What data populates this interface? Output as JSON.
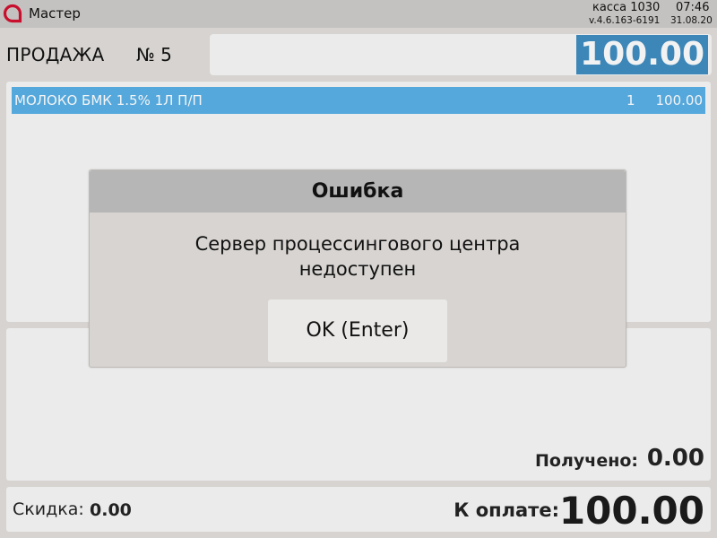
{
  "titlebar": {
    "user_name": "Мастер",
    "kassa": "касса 1030",
    "time": "07:46",
    "version": "v.4.6.163-6191",
    "date": "31.08.20",
    "logo_icon": "brand-logo-icon",
    "brand_color": "#c8102e"
  },
  "sale": {
    "label": "ПРОДАЖА",
    "number": "№ 5",
    "total": "100.00"
  },
  "receipt": {
    "items": [
      {
        "name": "МОЛОКО БМК 1.5% 1Л П/П",
        "qty": "1",
        "sum": "100.00"
      }
    ],
    "selected_color": "#55a8dc"
  },
  "payment": {
    "received_label": "Получено:",
    "received_value": "0.00"
  },
  "footer": {
    "discount_label": "Скидка:",
    "discount_value": "0.00",
    "topay_label": "К оплате:",
    "topay_value": "100.00"
  },
  "dialog": {
    "title": "Ошибка",
    "message_line1": "Сервер процессингового центра",
    "message_line2": "недоступен",
    "ok_label": "OK (Enter)"
  }
}
